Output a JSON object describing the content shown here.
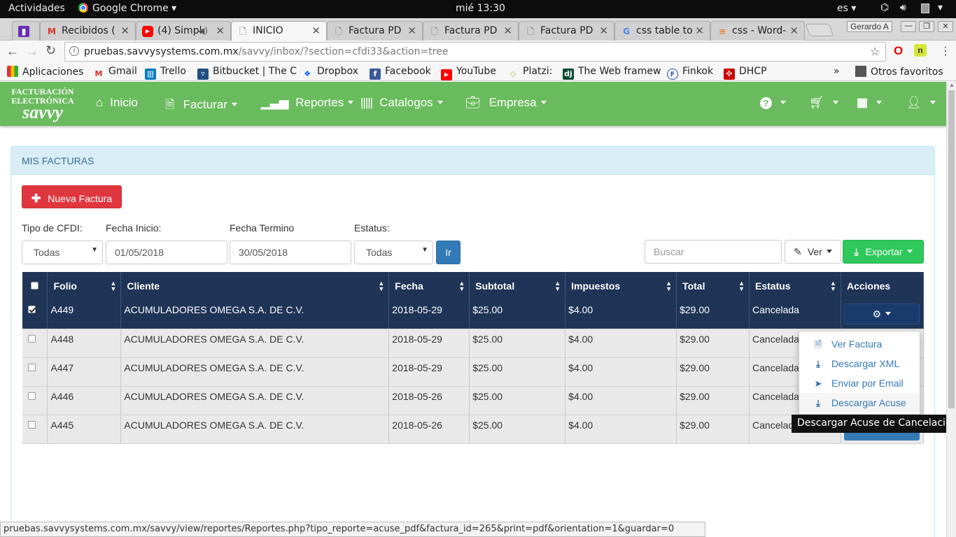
{
  "system_bar": {
    "activities": "Actividades",
    "app": "Google Chrome",
    "clock": "mié 13:30",
    "lang": "es"
  },
  "tabs": [
    {
      "title": "Recibidos (",
      "icon": "gmail-icon"
    },
    {
      "title": "(4) Simpl",
      "icon": "youtube-icon"
    },
    {
      "title": "INICIO",
      "icon": "page-icon"
    },
    {
      "title": "Factura PD",
      "icon": "page-icon"
    },
    {
      "title": "Factura PD",
      "icon": "page-icon"
    },
    {
      "title": "Factura PD",
      "icon": "page-icon"
    },
    {
      "title": "css table to",
      "icon": "google-icon"
    },
    {
      "title": "css - Word-",
      "icon": "stackoverflow-icon"
    }
  ],
  "profile_name": "Gerardo A",
  "address": {
    "host": "pruebas.savvysystems.com.mx",
    "path": "/savvy/inbox/?section=cfdi33&action=tree"
  },
  "bookmarks": [
    "Aplicaciones",
    "Gmail",
    "Trello",
    "Bitbucket | The C",
    "Dropbox",
    "Facebook",
    "YouTube",
    "Platzi:",
    "The Web framew",
    "Finkok",
    "DHCP"
  ],
  "bookmarks_more": "»",
  "bookmarks_other": "Otros favoritos",
  "logo": {
    "line1": "FACTURACIÓN",
    "line2": "ELECTRÓNICA",
    "line3": "savvy"
  },
  "nav": {
    "inicio": "Inicio",
    "facturar": "Facturar",
    "reportes": "Reportes",
    "catalogos": "Catalogos",
    "empresa": "Empresa"
  },
  "panel_title": "MIS FACTURAS",
  "new_invoice": "Nueva Factura",
  "filters": {
    "tipo_label": "Tipo de CFDI:",
    "tipo_value": "Todas",
    "inicio_label": "Fecha Inicio:",
    "inicio_value": "01/05/2018",
    "termino_label": "Fecha Termino",
    "termino_value": "30/05/2018",
    "estatus_label": "Estatus:",
    "estatus_value": "Todas",
    "go": "Ir",
    "search_placeholder": "Buscar",
    "ver": "Ver",
    "exportar": "Exportar"
  },
  "table": {
    "headers": [
      "Folio",
      "Cliente",
      "Fecha",
      "Subtotal",
      "Impuestos",
      "Total",
      "Estatus",
      "Acciones"
    ],
    "rows": [
      {
        "folio": "A449",
        "cliente": "ACUMULADORES OMEGA S.A. DE C.V.",
        "fecha": "2018-05-29",
        "subtotal": "$25.00",
        "impuestos": "$4.00",
        "total": "$29.00",
        "estatus": "Cancelada",
        "checked": true
      },
      {
        "folio": "A448",
        "cliente": "ACUMULADORES OMEGA S.A. DE C.V.",
        "fecha": "2018-05-29",
        "subtotal": "$25.00",
        "impuestos": "$4.00",
        "total": "$29.00",
        "estatus": "Cancelada",
        "checked": false
      },
      {
        "folio": "A447",
        "cliente": "ACUMULADORES OMEGA S.A. DE C.V.",
        "fecha": "2018-05-29",
        "subtotal": "$25.00",
        "impuestos": "$4.00",
        "total": "$29.00",
        "estatus": "Cancelada",
        "checked": false
      },
      {
        "folio": "A446",
        "cliente": "ACUMULADORES OMEGA S.A. DE C.V.",
        "fecha": "2018-05-26",
        "subtotal": "$25.00",
        "impuestos": "$4.00",
        "total": "$29.00",
        "estatus": "Cancelada",
        "checked": false
      },
      {
        "folio": "A445",
        "cliente": "ACUMULADORES OMEGA S.A. DE C.V.",
        "fecha": "2018-05-26",
        "subtotal": "$25.00",
        "impuestos": "$4.00",
        "total": "$29.00",
        "estatus": "Cancelad",
        "checked": false
      }
    ]
  },
  "actions_menu": [
    "Ver Factura",
    "Descargar XML",
    "Enviar por Email",
    "Descargar Acuse"
  ],
  "tooltip": "Descargar Acuse de Cancelación",
  "status_url": "pruebas.savvysystems.com.mx/savvy/view/reportes/Reportes.php?tipo_reporte=acuse_pdf&factura_id=265&print=pdf&orientation=1&guardar=0",
  "colors": {
    "navbar": "#6abb5d",
    "table_header": "#1f3557",
    "danger": "#e0363f",
    "success": "#2ec95a",
    "primary": "#337ab7"
  }
}
